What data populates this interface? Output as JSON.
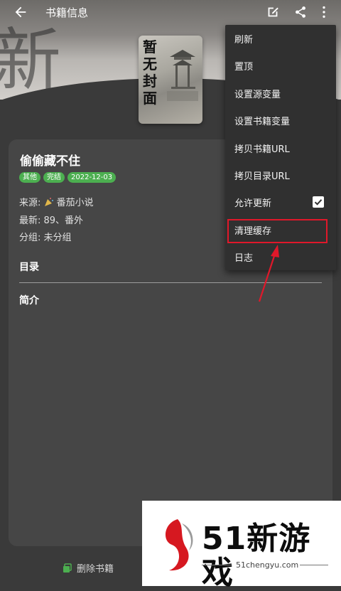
{
  "header": {
    "title": "书籍信息",
    "back_icon": "arrow-left-icon"
  },
  "toolbar": {
    "edit_icon": "edit-icon",
    "share_icon": "share-icon",
    "more_icon": "more-vert-icon"
  },
  "cover": {
    "text": "暂无封面"
  },
  "book": {
    "title": "偷偷藏不住",
    "tags": [
      "其他",
      "完结",
      "2022-12-03"
    ],
    "source_label": "来源:",
    "source_value": "番茄小说",
    "latest": "最新: 89、番外",
    "group": "分组: 未分组",
    "catalog_label": "目录",
    "intro_label": "简介"
  },
  "footer": {
    "delete_label": "删除书籍"
  },
  "menu": {
    "items": [
      {
        "label": "刷新"
      },
      {
        "label": "置顶"
      },
      {
        "label": "设置源变量"
      },
      {
        "label": "设置书籍变量"
      },
      {
        "label": "拷贝书籍URL"
      },
      {
        "label": "拷贝目录URL"
      },
      {
        "label": "允许更新",
        "checked": true
      },
      {
        "label": "清理缓存",
        "highlighted": true
      },
      {
        "label": "日志"
      }
    ]
  },
  "watermark": {
    "brand": "51新游戏",
    "url": "51chengyu.com"
  },
  "colors": {
    "accent_tag": "#4caf50",
    "highlight_border": "#e0182a",
    "menu_bg": "#303030"
  }
}
